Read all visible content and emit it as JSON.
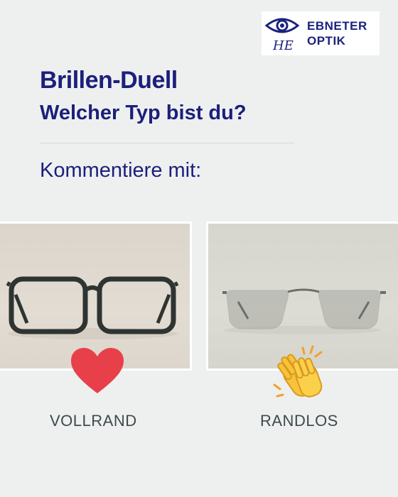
{
  "brand": {
    "line1": "EBNETER",
    "line2": "OPTIK",
    "monogram": "HE",
    "logo_icon": "eye-icon",
    "color": "#1a237e"
  },
  "header": {
    "title": "Brillen-Duell",
    "subtitle": "Welcher Typ bist du?"
  },
  "instruction": "Kommentiere mit:",
  "options": [
    {
      "label": "VOLLRAND",
      "reaction_icon": "red-heart-icon",
      "reaction_color": "#e8404a"
    },
    {
      "label": "RANDLOS",
      "reaction_icon": "clapping-hands-icon",
      "reaction_color": "#f6c33a"
    }
  ],
  "colors": {
    "background": "#eef0f0",
    "heading": "#1c1f7a",
    "label": "#3f4a4c"
  }
}
